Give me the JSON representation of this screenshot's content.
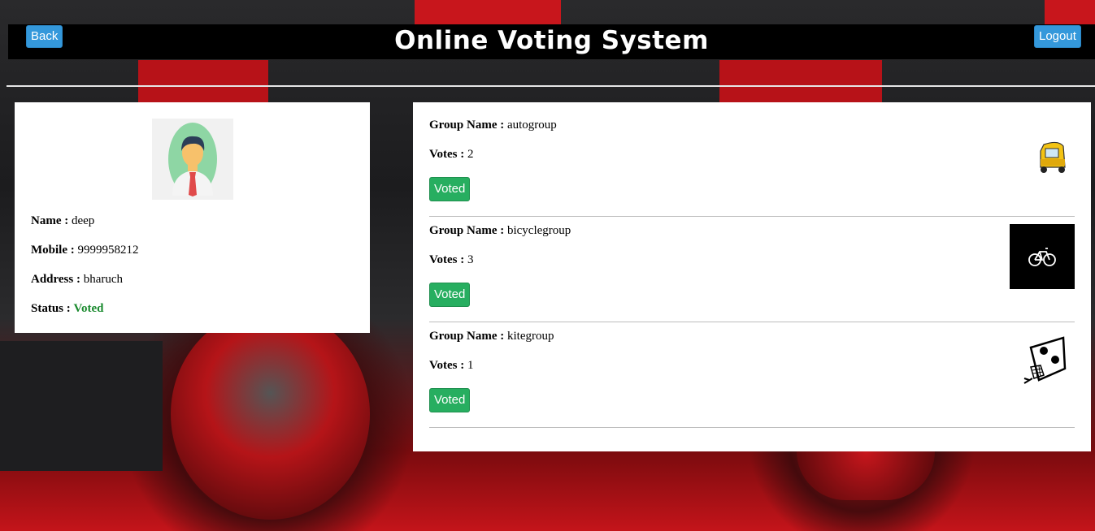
{
  "header": {
    "title": "Online Voting System",
    "back_label": "Back",
    "logout_label": "Logout"
  },
  "profile": {
    "name_label": "Name :",
    "name": "deep",
    "mobile_label": "Mobile :",
    "mobile": "9999958212",
    "address_label": "Address :",
    "address": "bharuch",
    "status_label": "Status :",
    "status": "Voted"
  },
  "groups": [
    {
      "name_label": "Group Name :",
      "name": "autogroup",
      "votes_label": "Votes :",
      "votes": "2",
      "button": "Voted",
      "icon": "auto-rickshaw-icon"
    },
    {
      "name_label": "Group Name :",
      "name": "bicyclegroup",
      "votes_label": "Votes :",
      "votes": "3",
      "button": "Voted",
      "icon": "bicycle-icon"
    },
    {
      "name_label": "Group Name :",
      "name": "kitegroup",
      "votes_label": "Votes :",
      "votes": "1",
      "button": "Voted",
      "icon": "kite-icon"
    }
  ],
  "colors": {
    "header_bg": "#000000",
    "primary_button": "#3498db",
    "voted_button": "#27ae60",
    "voted_status": "#1a8a2e",
    "background_accent": "#c4141a"
  }
}
